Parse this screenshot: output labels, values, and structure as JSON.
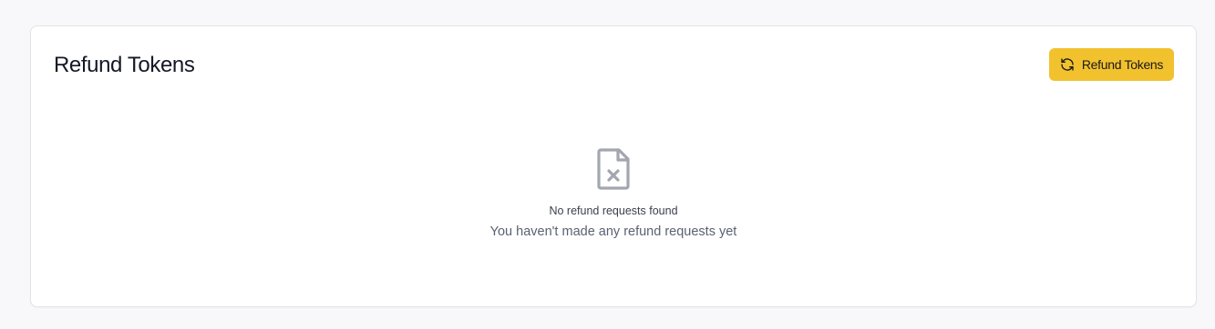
{
  "card": {
    "title": "Refund Tokens",
    "button_label": "Refund Tokens",
    "button_icon": "refresh-icon",
    "accent_color": "#f2c12e"
  },
  "empty_state": {
    "icon": "file-x-icon",
    "title": "No refund requests found",
    "subtitle": "You haven't made any refund requests yet"
  }
}
